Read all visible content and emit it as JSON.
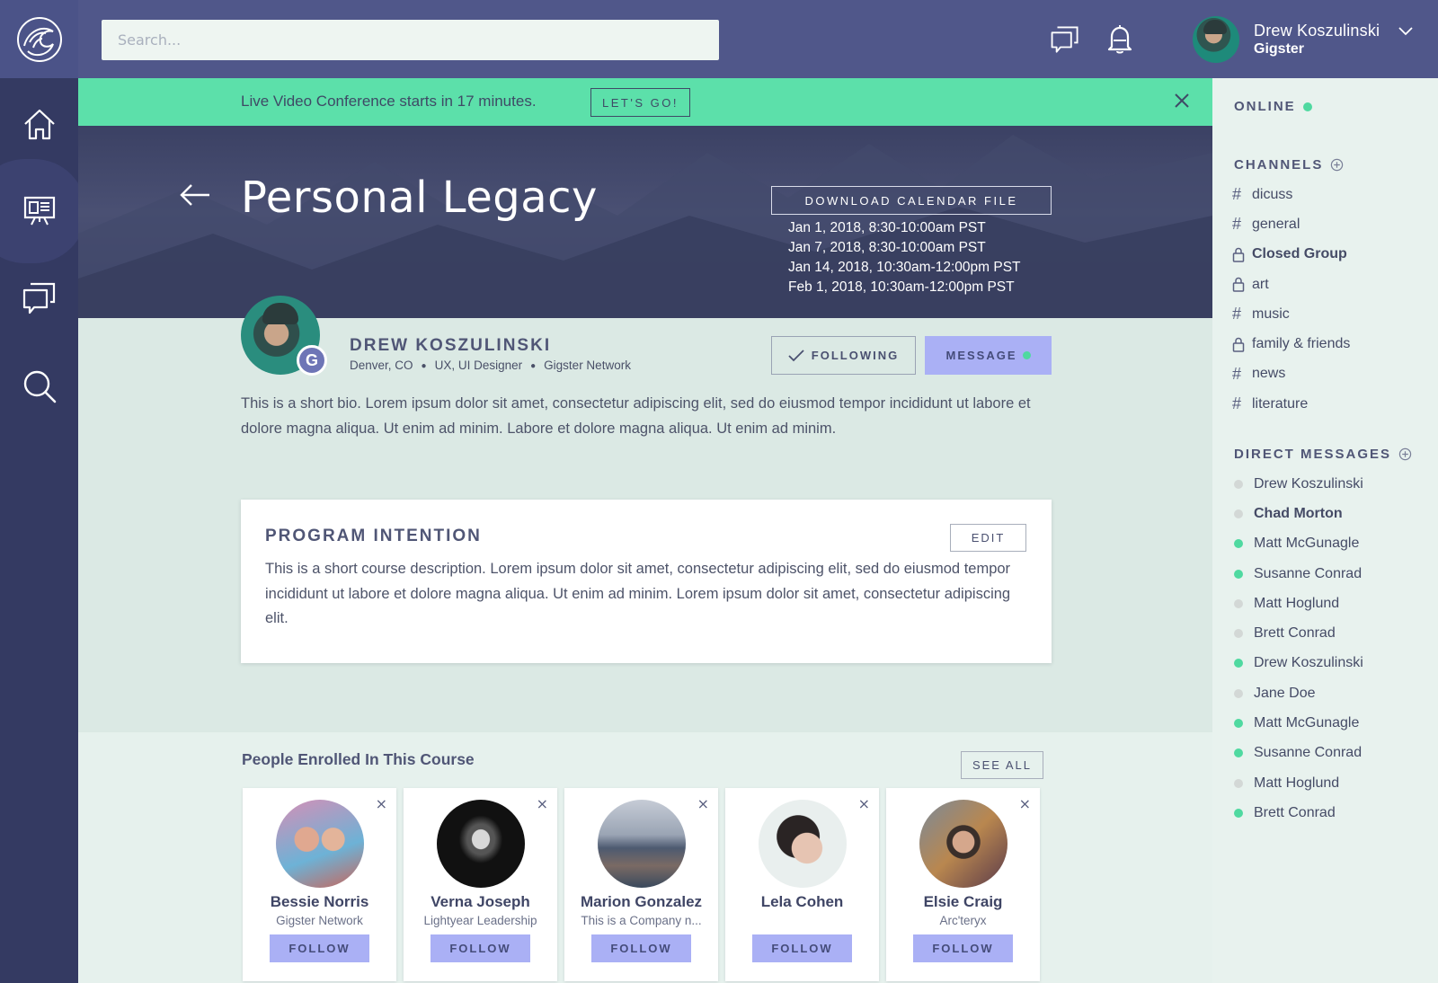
{
  "search": {
    "placeholder": "Search..."
  },
  "user": {
    "name": "Drew Koszulinski",
    "role": "Gigster"
  },
  "banner": {
    "text": "Live Video Conference starts in 17 minutes.",
    "button": "LET'S GO!"
  },
  "hero": {
    "title": "Personal Legacy",
    "download_label": "DOWNLOAD CALENDAR FILE",
    "dates": [
      "Jan 1, 2018, 8:30-10:00am PST",
      "Jan 7, 2018, 8:30-10:00am PST",
      "Jan 14, 2018, 10:30am-12:00pm PST",
      "Feb 1, 2018, 10:30am-12:00pm PST"
    ]
  },
  "profile": {
    "badge": "G",
    "name": "DREW KOSZULINSKI",
    "location": "Denver, CO",
    "title": "UX, UI Designer",
    "network": "Gigster Network",
    "following_label": "FOLLOWING",
    "message_label": "MESSAGE",
    "bio": "This is a short bio. Lorem ipsum dolor sit amet, consectetur adipiscing elit, sed do eiusmod tempor incididunt ut labore et dolore magna aliqua. Ut enim ad minim. Labore et dolore magna aliqua. Ut enim ad minim."
  },
  "program": {
    "title": "PROGRAM INTENTION",
    "edit_label": "EDIT",
    "description": "This is a short course description. Lorem ipsum dolor sit amet, consectetur adipiscing elit, sed do eiusmod tempor incididunt ut labore et dolore magna aliqua. Ut enim ad minim. Lorem ipsum dolor sit amet, consectetur adipiscing elit."
  },
  "enrolled": {
    "title": "People Enrolled In This Course",
    "see_all_label": "SEE ALL",
    "close_glyph": "×",
    "people": [
      {
        "name": "Bessie Norris",
        "org": "Gigster Network",
        "follow": "FOLLOW"
      },
      {
        "name": "Verna Joseph",
        "org": "Lightyear Leadership",
        "follow": "FOLLOW"
      },
      {
        "name": "Marion Gonzalez",
        "org": "This is a Company n...",
        "follow": "FOLLOW"
      },
      {
        "name": "Lela Cohen",
        "org": "",
        "follow": "FOLLOW"
      },
      {
        "name": "Elsie Craig",
        "org": "Arc'teryx",
        "follow": "FOLLOW"
      }
    ]
  },
  "sidebar": {
    "online_label": "ONLINE",
    "channels_label": "CHANNELS",
    "channels": [
      {
        "name": "dicuss",
        "type": "hash",
        "glyph": "#"
      },
      {
        "name": "general",
        "type": "hash",
        "glyph": "#"
      },
      {
        "name": "Closed Group",
        "type": "lock",
        "bold": true
      },
      {
        "name": "art",
        "type": "lock"
      },
      {
        "name": "music",
        "type": "hash",
        "glyph": "#"
      },
      {
        "name": "family & friends",
        "type": "lock"
      },
      {
        "name": "news",
        "type": "hash",
        "glyph": "#"
      },
      {
        "name": "literature",
        "type": "hash",
        "glyph": "#"
      }
    ],
    "dm_label": "DIRECT MESSAGES",
    "direct_messages": [
      {
        "name": "Drew Koszulinski",
        "online": false
      },
      {
        "name": "Chad Morton",
        "online": false,
        "bold": true
      },
      {
        "name": "Matt McGunagle",
        "online": true
      },
      {
        "name": "Susanne Conrad",
        "online": true
      },
      {
        "name": "Matt Hoglund",
        "online": false
      },
      {
        "name": "Brett Conrad",
        "online": false
      },
      {
        "name": "Drew Koszulinski",
        "online": true
      },
      {
        "name": "Jane Doe",
        "online": false
      },
      {
        "name": "Matt McGunagle",
        "online": true
      },
      {
        "name": "Susanne Conrad",
        "online": true
      },
      {
        "name": "Matt Hoglund",
        "online": false
      },
      {
        "name": "Brett Conrad",
        "online": true
      }
    ]
  },
  "colors": {
    "online": "#4fd9a0",
    "offline": "#d3d8d6",
    "accent": "#aab0f5",
    "banner": "#5ce0aa",
    "nav": "#343a62",
    "topbar": "#50578a"
  }
}
